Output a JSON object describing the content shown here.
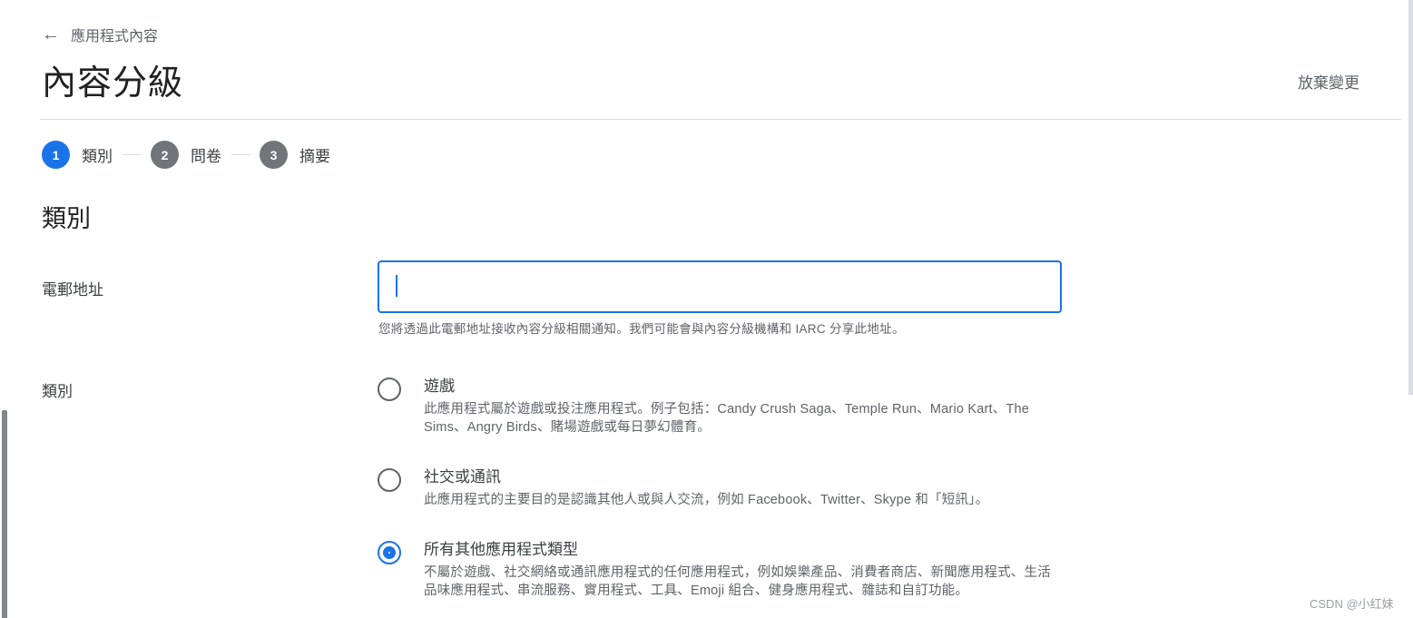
{
  "header": {
    "back_label": "應用程式內容",
    "back_icon": "arrow-left-icon",
    "title": "內容分級",
    "discard_label": "放棄變更"
  },
  "stepper": {
    "steps": [
      {
        "number": "1",
        "label": "類別",
        "active": true
      },
      {
        "number": "2",
        "label": "問卷",
        "active": false
      },
      {
        "number": "3",
        "label": "摘要",
        "active": false
      }
    ],
    "active_color": "#1a73e8",
    "inactive_color": "#70757a"
  },
  "section": {
    "title": "類別"
  },
  "email": {
    "label": "電郵地址",
    "value": "",
    "placeholder": "",
    "help": "您將透過此電郵地址接收內容分級相關通知。我們可能會與內容分級機構和 IARC 分享此地址。"
  },
  "category": {
    "label": "類別",
    "options": [
      {
        "title": "遊戲",
        "description": "此應用程式屬於遊戲或投注應用程式。例子包括：Candy Crush Saga、Temple Run、Mario Kart、The Sims、Angry Birds、賭場遊戲或每日夢幻體育。",
        "selected": false
      },
      {
        "title": "社交或通訊",
        "description": "此應用程式的主要目的是認識其他人或與人交流，例如 Facebook、Twitter、Skype 和「短訊」。",
        "selected": false
      },
      {
        "title": "所有其他應用程式類型",
        "description": "不屬於遊戲、社交網絡或通訊應用程式的任何應用程式，例如娛樂產品、消費者商店、新聞應用程式、生活品味應用程式、串流服務、實用程式、工具、Emoji 組合、健身應用程式、雜誌和自訂功能。",
        "selected": true
      }
    ]
  },
  "watermark": "CSDN @小红妹"
}
